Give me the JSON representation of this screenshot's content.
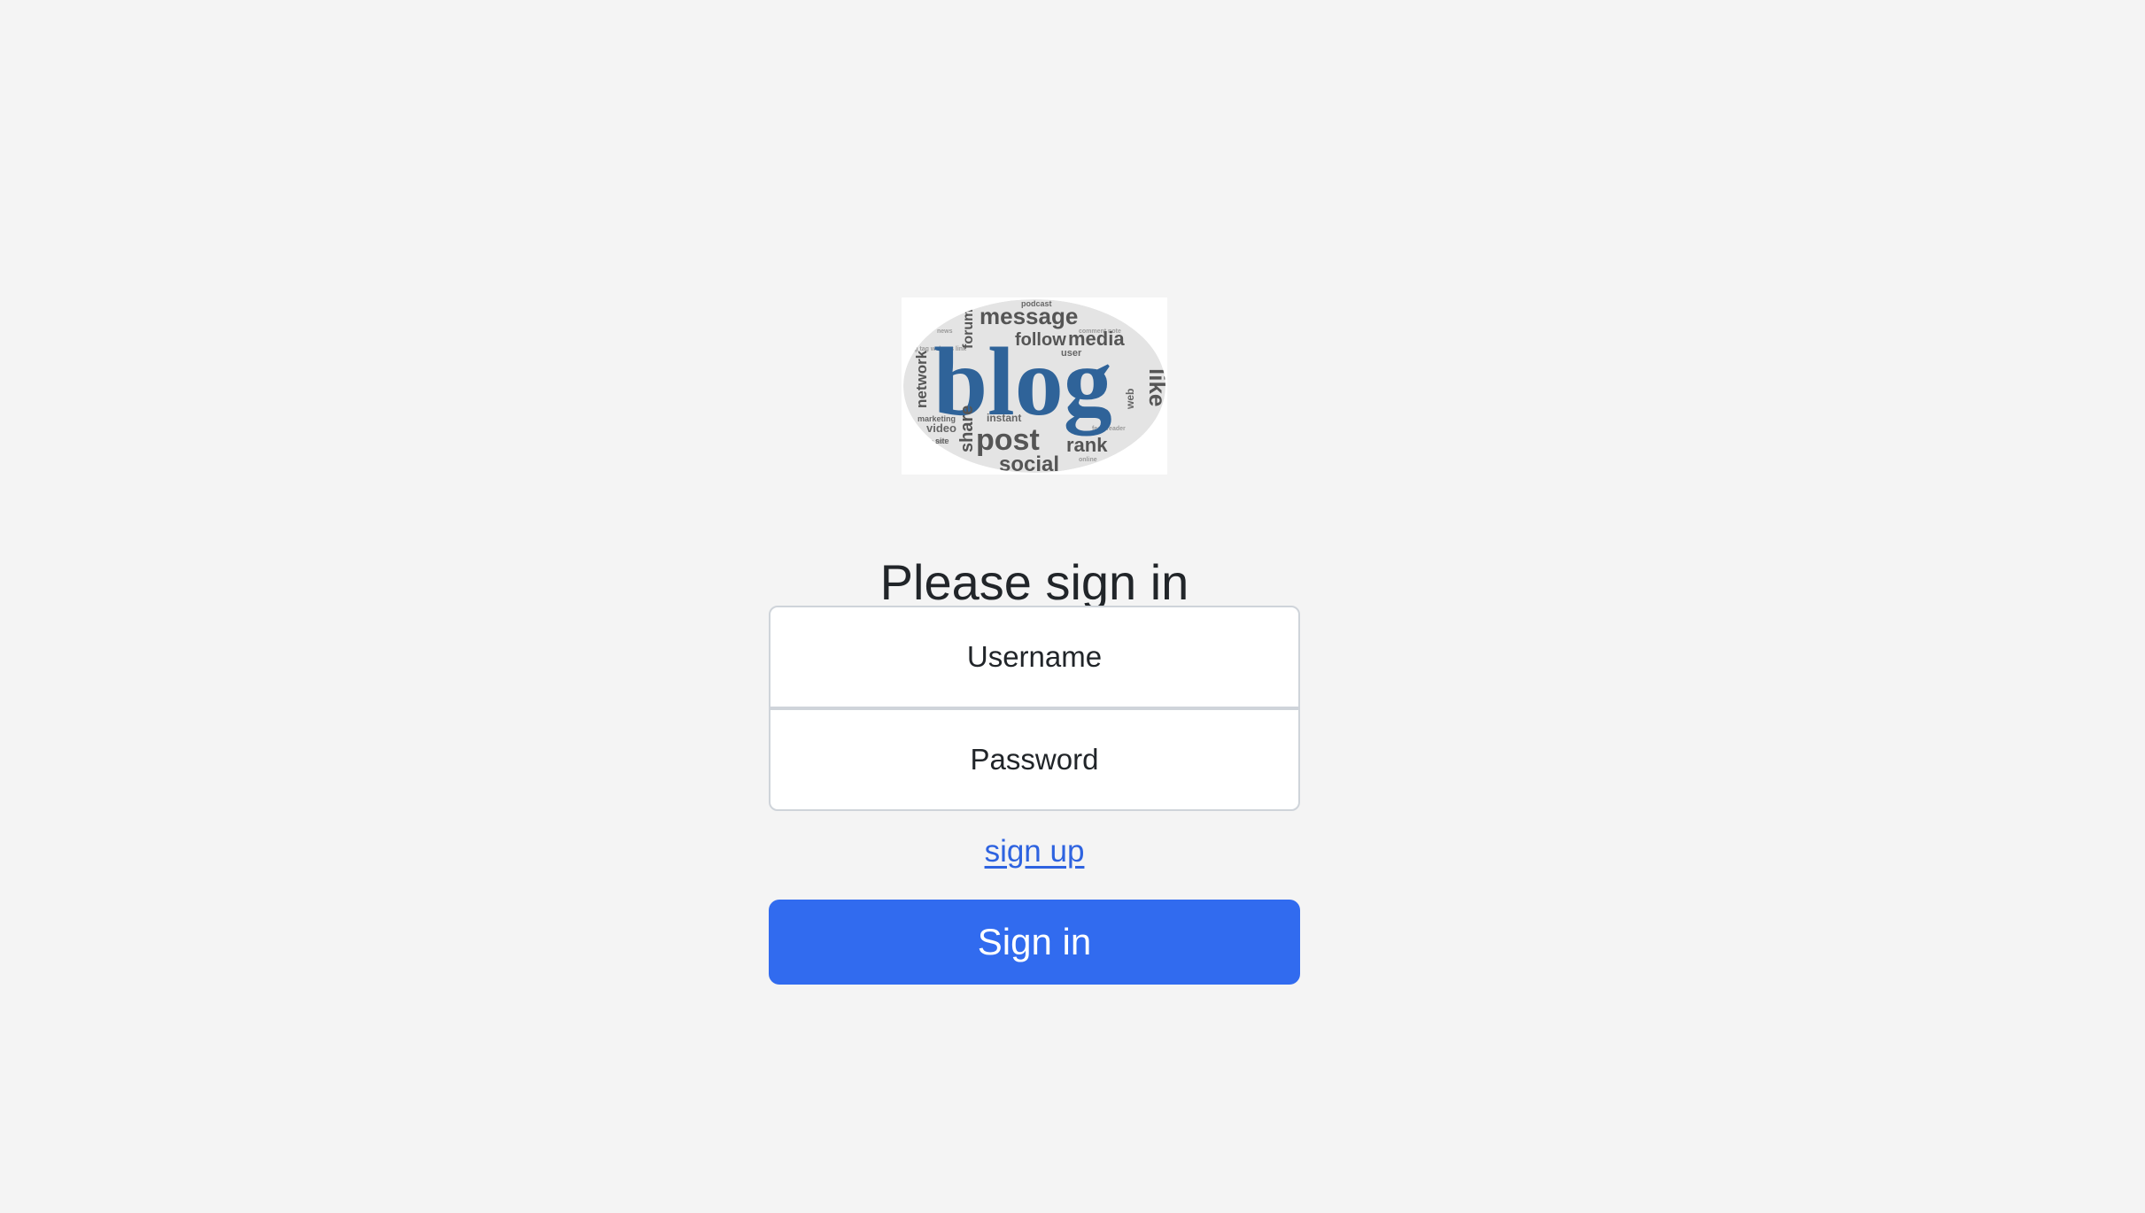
{
  "logo": {
    "words": {
      "main": "blog",
      "message": "message",
      "follow": "follow",
      "media": "media",
      "forum": "forum",
      "network": "network",
      "like": "like",
      "web": "web",
      "post": "post",
      "social": "social",
      "rank": "rank",
      "share": "share",
      "video": "video",
      "instant": "instant",
      "marketing": "marketing",
      "user": "user",
      "podcast": "podcast",
      "site": "site"
    },
    "colors": {
      "main": "#2f6399",
      "words": "#555555"
    }
  },
  "heading": "Please sign in",
  "form": {
    "username_placeholder": "Username",
    "password_placeholder": "Password",
    "signup_link": "sign up",
    "submit_label": "Sign in"
  },
  "colors": {
    "background": "#f4f4f4",
    "primary": "#316bef",
    "link": "#2e63e0"
  }
}
